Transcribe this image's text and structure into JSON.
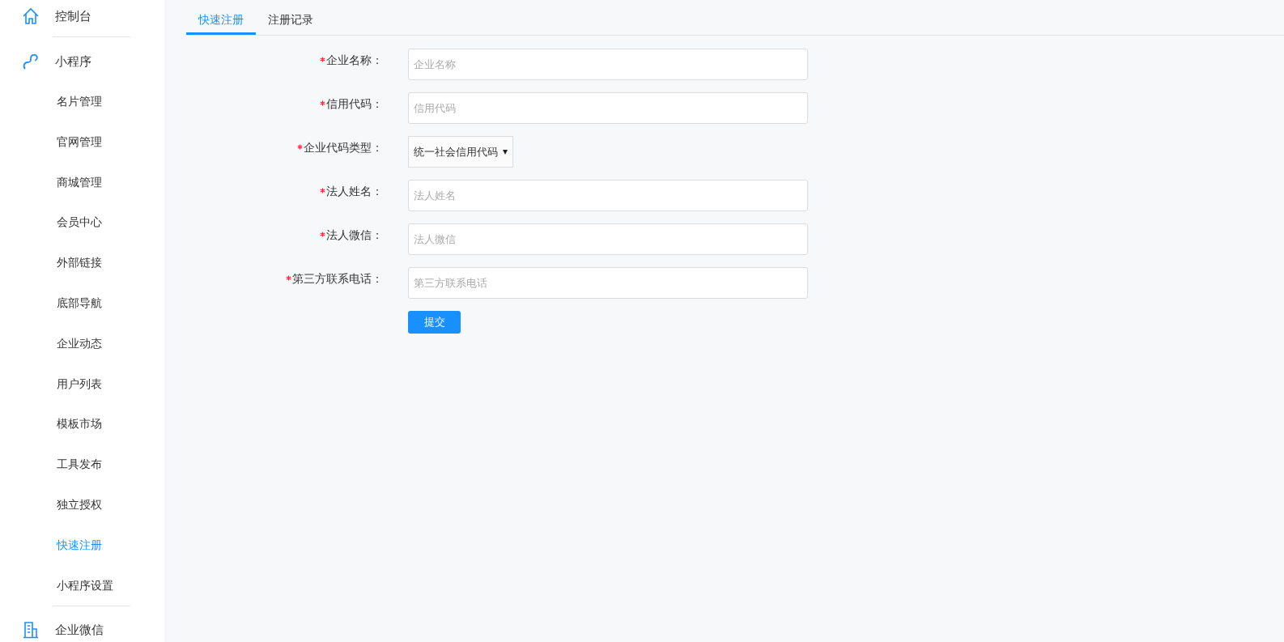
{
  "sidebar": {
    "sections": [
      {
        "label": "控制台",
        "selected": false
      },
      {
        "label": "小程序",
        "selected": false,
        "items": [
          {
            "label": "名片管理",
            "selected": false
          },
          {
            "label": "官网管理",
            "selected": false
          },
          {
            "label": "商城管理",
            "selected": false
          },
          {
            "label": "会员中心",
            "selected": false
          },
          {
            "label": "外部链接",
            "selected": false
          },
          {
            "label": "底部导航",
            "selected": false
          },
          {
            "label": "企业动态",
            "selected": false
          },
          {
            "label": "用户列表",
            "selected": false
          },
          {
            "label": "模板市场",
            "selected": false
          },
          {
            "label": "工具发布",
            "selected": false
          },
          {
            "label": "独立授权",
            "selected": false
          },
          {
            "label": "快速注册",
            "selected": true
          },
          {
            "label": "小程序设置",
            "selected": false
          }
        ]
      },
      {
        "label": "企业微信",
        "selected": false
      }
    ]
  },
  "tabs": [
    {
      "label": "快速注册",
      "selected": true
    },
    {
      "label": "注册记录",
      "selected": false
    }
  ],
  "form": {
    "fields": [
      {
        "kind": "text",
        "label": "企业名称：",
        "required": true,
        "placeholder": "企业名称"
      },
      {
        "kind": "text",
        "label": "信用代码：",
        "required": true,
        "placeholder": "信用代码"
      },
      {
        "kind": "select",
        "label": "企业代码类型：",
        "required": true,
        "value": "统一社会信用代码"
      },
      {
        "kind": "text",
        "label": "法人姓名：",
        "required": true,
        "placeholder": "法人姓名"
      },
      {
        "kind": "text",
        "label": "法人微信：",
        "required": true,
        "placeholder": "法人微信"
      },
      {
        "kind": "text",
        "label": "第三方联系电话：",
        "required": true,
        "placeholder": "第三方联系电话"
      }
    ],
    "submit": "提交"
  }
}
